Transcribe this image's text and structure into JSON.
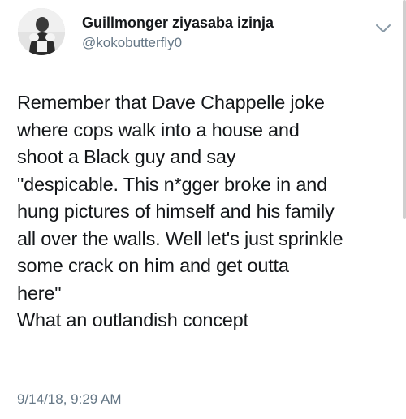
{
  "user": {
    "display_name": "Guillmonger ziyasaba izinja",
    "handle": "@kokobutterfly0"
  },
  "tweet": {
    "lines": [
      "Remember that Dave Chappelle joke",
      "where cops walk into a house and",
      "shoot a Black guy and say",
      "\"despicable. This n*gger broke in and",
      "hung pictures of himself and his family",
      "all over the walls. Well let's just sprinkle",
      "some crack on him and get outta",
      "here\"",
      "What an outlandish concept"
    ],
    "timestamp": "9/14/18, 9:29 AM"
  },
  "icons": {
    "menu": "chevron-down-icon",
    "avatar": "avatar"
  },
  "colors": {
    "text_primary": "#14171a",
    "text_secondary": "#657786",
    "background": "#ffffff"
  }
}
